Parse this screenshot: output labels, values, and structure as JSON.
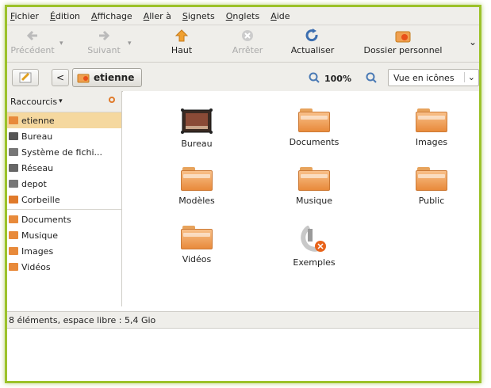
{
  "menu": [
    "Fichier",
    "Édition",
    "Affichage",
    "Aller à",
    "Signets",
    "Onglets",
    "Aide"
  ],
  "toolbar": {
    "back": "Précédent",
    "forward": "Suivant",
    "up": "Haut",
    "stop": "Arrêter",
    "reload": "Actualiser",
    "home": "Dossier personnel",
    "overflow": "⌄"
  },
  "location": {
    "back_arrow": "<",
    "current": "etienne",
    "zoom": "100%",
    "view_mode": "Vue en icônes",
    "dropdown_arrow": "⌄"
  },
  "sidebar": {
    "header": "Raccourcis",
    "items": [
      {
        "label": "etienne",
        "icon": "home-icon",
        "color": "#e88a3b"
      },
      {
        "label": "Bureau",
        "icon": "desktop-icon",
        "color": "#555555"
      },
      {
        "label": "Système de fichi...",
        "icon": "drive-icon",
        "color": "#777777"
      },
      {
        "label": "Réseau",
        "icon": "network-icon",
        "color": "#666666"
      },
      {
        "label": "depot",
        "icon": "drive-icon",
        "color": "#777777"
      },
      {
        "label": "Corbeille",
        "icon": "trash-icon",
        "color": "#e07a2a"
      }
    ],
    "bookmarks": [
      {
        "label": "Documents",
        "icon": "folder-icon"
      },
      {
        "label": "Musique",
        "icon": "folder-icon"
      },
      {
        "label": "Images",
        "icon": "folder-icon"
      },
      {
        "label": "Vidéos",
        "icon": "folder-icon"
      }
    ]
  },
  "files": [
    {
      "label": "Bureau",
      "icon": "desktop-icon"
    },
    {
      "label": "Documents",
      "icon": "folder-icon"
    },
    {
      "label": "Images",
      "icon": "folder-icon"
    },
    {
      "label": "Modèles",
      "icon": "folder-icon"
    },
    {
      "label": "Musique",
      "icon": "folder-icon"
    },
    {
      "label": "Public",
      "icon": "folder-icon"
    },
    {
      "label": "Vidéos",
      "icon": "folder-icon"
    },
    {
      "label": "Exemples",
      "icon": "examples-icon"
    }
  ],
  "status": "8 éléments, espace libre : 5,4 Gio",
  "colors": {
    "accent": "#9cc22a",
    "folder": "#e88a3b",
    "selection": "#f5d89f"
  }
}
